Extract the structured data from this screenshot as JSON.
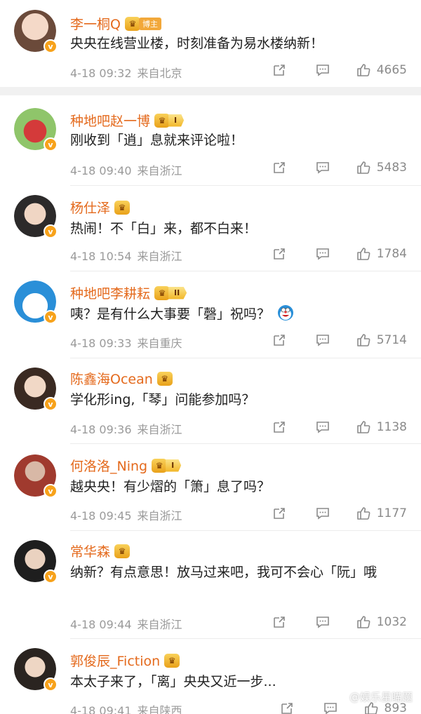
{
  "comments": [
    {
      "name": "李一桐Q",
      "badge": "博主",
      "text": "央央在线营业楼，时刻准备为易水楼纳新！",
      "date": "4-18 09:32",
      "location": "来自北京",
      "likes": "4665",
      "level": ""
    },
    {
      "name": "种地吧赵一博",
      "badge": "",
      "text": "刚收到「逍」息就来评论啦！",
      "date": "4-18 09:40",
      "location": "来自浙江",
      "likes": "5483",
      "level": "I"
    },
    {
      "name": "杨仕泽",
      "badge": "",
      "text": "热闹！不「白」来，都不白来！",
      "date": "4-18 10:54",
      "location": "来自浙江",
      "likes": "1784",
      "level": ""
    },
    {
      "name": "种地吧李耕耘",
      "badge": "",
      "text": "咦？是有什么大事要「磬」祝吗？",
      "date": "4-18 09:33",
      "location": "来自重庆",
      "likes": "5714",
      "level": "II"
    },
    {
      "name": "陈鑫海Ocean",
      "badge": "",
      "text": "学化形ing,「琴」问能参加吗？",
      "date": "4-18 09:36",
      "location": "来自浙江",
      "likes": "1138",
      "level": ""
    },
    {
      "name": "何洛洛_Ning",
      "badge": "",
      "text": "越央央！有少熠的「箫」息了吗？",
      "date": "4-18 09:45",
      "location": "来自浙江",
      "likes": "1177",
      "level": "I"
    },
    {
      "name": "常华森",
      "badge": "",
      "text": "纳新？有点意思！放马过来吧，我可不会心「阮」哦",
      "date": "4-18 09:44",
      "location": "来自浙江",
      "likes": "1032",
      "level": ""
    },
    {
      "name": "郭俊辰_Fiction",
      "badge": "",
      "text": "本太子来了，「离」央央又近一步...",
      "date": "4-18 09:41",
      "location": "来自陕西",
      "likes": "893",
      "level": ""
    }
  ],
  "verified_mark": "v",
  "crown_mark": "♛",
  "watermark": "@娱乐星瞄题",
  "colors": {
    "name": "#e46a1d",
    "meta": "#9a9a9a",
    "badge": "#f7a21b"
  },
  "icons": {
    "share": "share-icon",
    "comment": "comment-icon",
    "like": "thumbs-up-icon",
    "verified": "verified-badge-icon",
    "crown": "crown-icon",
    "emoji": "doraemon-emoji-icon"
  }
}
